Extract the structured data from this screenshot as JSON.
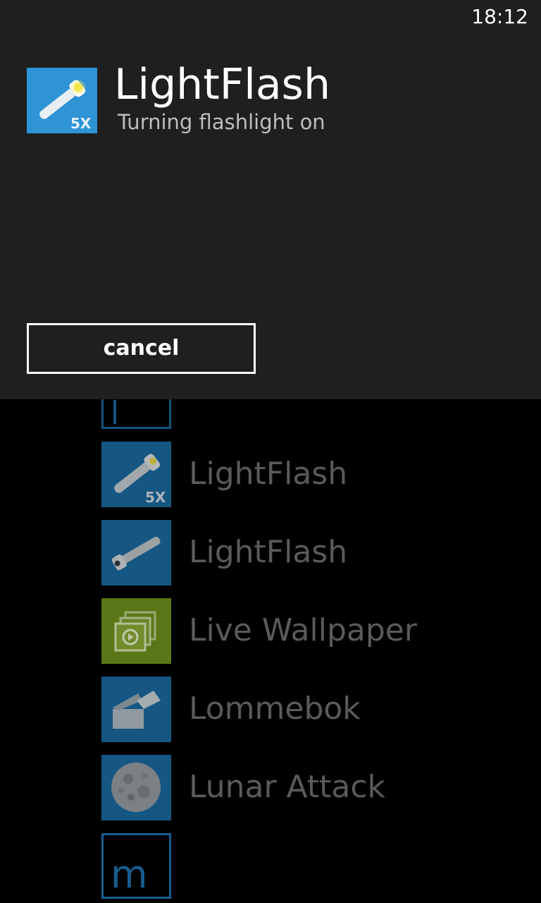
{
  "status_bar": {
    "time": "18:12"
  },
  "dialog": {
    "title": "LightFlash",
    "message": "Turning flashlight on",
    "icon": "flashlight-5x-icon",
    "cancel_label": "cancel"
  },
  "app_list": {
    "items": [
      {
        "label": "LightFlash",
        "icon": "flashlight-5x-icon",
        "tile_color": "#1b6fa8"
      },
      {
        "label": "LightFlash",
        "icon": "flashlight-icon",
        "tile_color": "#1b6fa8"
      },
      {
        "label": "Live Wallpaper",
        "icon": "video-frame-icon",
        "tile_color": "#6a8c1c"
      },
      {
        "label": "Lommebok",
        "icon": "wallet-icon",
        "tile_color": "#1b6fa8"
      },
      {
        "label": "Lunar Attack",
        "icon": "moon-icon",
        "tile_color": "#1b6fa8"
      }
    ],
    "next_letter": "m"
  },
  "colors": {
    "accent": "#1b6fa8",
    "dialog_background": "#1f1f1f",
    "list_text": "#5a5a5a"
  }
}
